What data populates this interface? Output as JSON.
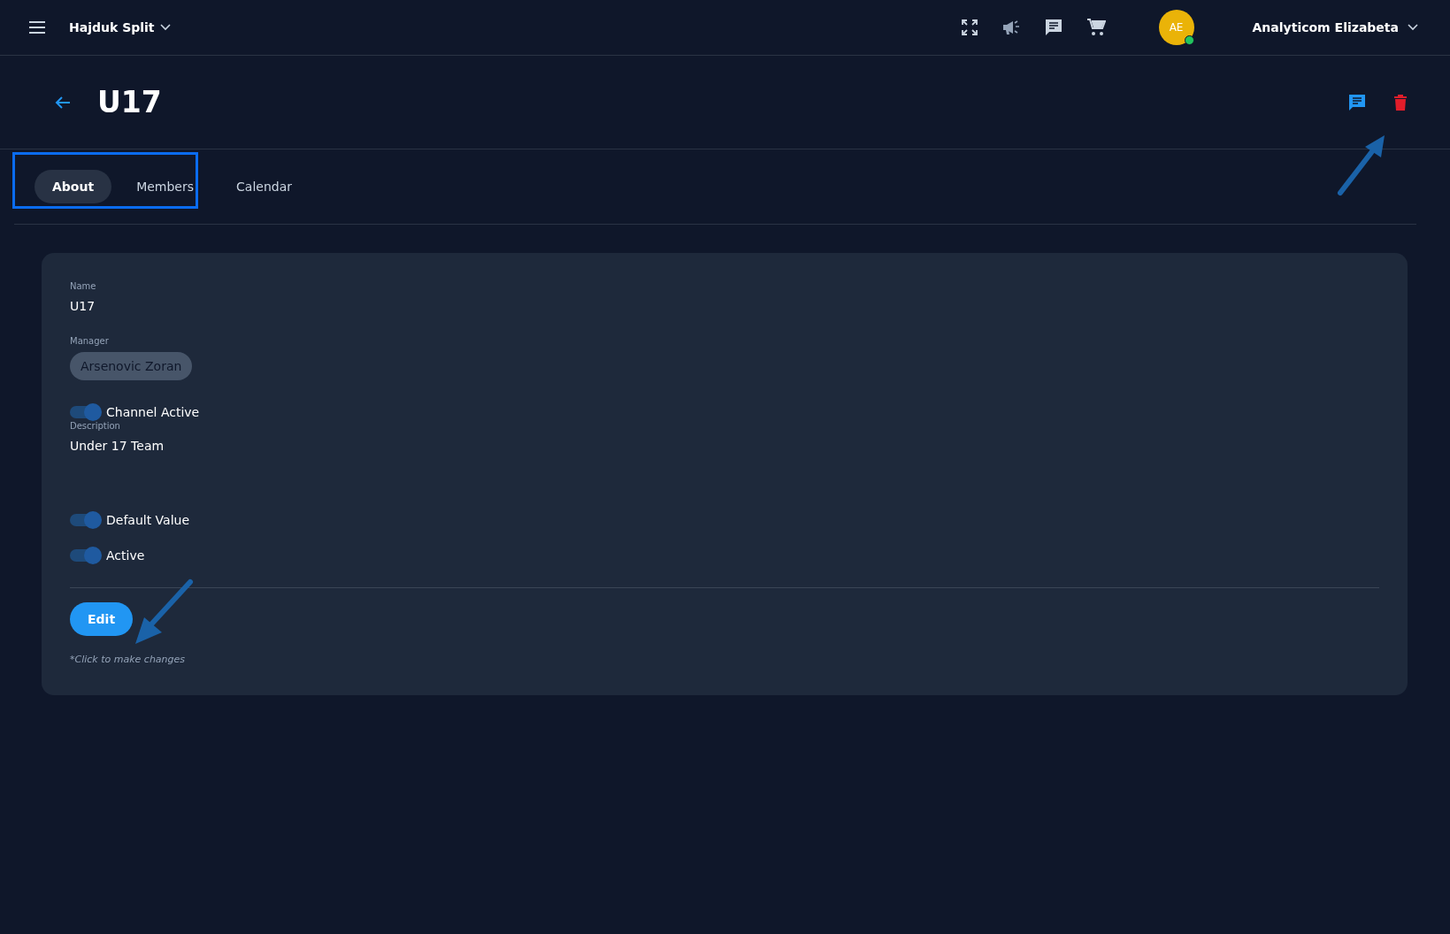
{
  "topbar": {
    "club": "Hajduk Split",
    "avatar": {
      "initials": "AE",
      "online": true
    },
    "user": "Analyticom Elizabeta"
  },
  "page": {
    "title": "U17"
  },
  "tabs": [
    {
      "label": "About",
      "selected": true
    },
    {
      "label": "Members",
      "selected": false
    },
    {
      "label": "Calendar",
      "selected": false
    }
  ],
  "card": {
    "fields": [
      {
        "kind": "text",
        "label": "Name",
        "value": "U17"
      },
      {
        "kind": "chip",
        "label": "Manager",
        "value": "Arsenovic Zoran"
      },
      {
        "kind": "toggle",
        "label": "Channel Active",
        "on": true
      },
      {
        "kind": "text",
        "label": "Description",
        "value": "Under 17 Team"
      },
      {
        "kind": "toggle",
        "label": "Default Value",
        "on": true
      },
      {
        "kind": "toggle",
        "label": "Active",
        "on": true
      }
    ],
    "button": "Edit",
    "hint": "*Click to make changes"
  }
}
